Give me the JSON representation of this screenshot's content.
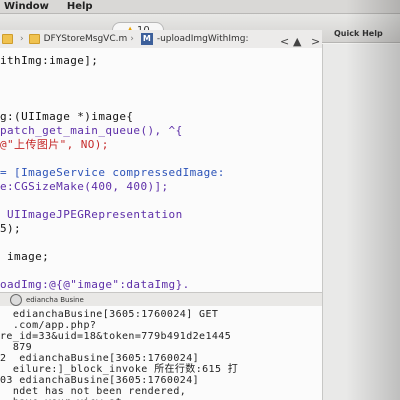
{
  "menu": [
    "Window",
    "Help"
  ],
  "toolbar": {
    "warning_count": "10"
  },
  "jumpbar": {
    "file_name": "DFYStoreMsgVC.m",
    "method_name": "-uploadImgWithImg:",
    "nav_prev": "<",
    "nav_next": ">"
  },
  "quick_help": {
    "title": "Quick Help"
  },
  "code_lines": [
    [
      {
        "text": "ithImg:image];",
        "class": "black"
      }
    ],
    [
      {
        "text": "",
        "class": "black"
      }
    ],
    [
      {
        "text": "",
        "class": "black"
      }
    ],
    [
      {
        "text": "",
        "class": "black"
      }
    ],
    [
      {
        "text": "g:(UIImage *)image{",
        "class": "black"
      }
    ],
    [
      {
        "text": "patch_get_main_queue(), ^{",
        "class": "purple"
      }
    ],
    [
      {
        "text": "@\"上传图片\", NO);",
        "class": "red"
      }
    ],
    [
      {
        "text": "",
        "class": "black"
      }
    ],
    [
      {
        "text": "= [ImageService compressedImage:",
        "class": "blue"
      }
    ],
    [
      {
        "text": "e:CGSizeMake(400, 400)];",
        "class": "purple"
      }
    ],
    [
      {
        "text": "",
        "class": "black"
      }
    ],
    [
      {
        "text": " UIImageJPEGRepresentation",
        "class": "purple"
      }
    ],
    [
      {
        "text": "5);",
        "class": "black"
      }
    ],
    [
      {
        "text": "",
        "class": "black"
      }
    ],
    [
      {
        "text": " image;",
        "class": "black"
      }
    ],
    [
      {
        "text": "",
        "class": "black"
      }
    ],
    [
      {
        "text": "oadImg:@{@\"image\":dataImg}.",
        "class": "purple"
      }
    ],
    [
      {
        "text": "success:^(id result) {",
        "class": "pink"
      }
    ],
    [
      {
        "text": "@\"result\"] isEqualToString:@\"0\"])",
        "class": "purple"
      }
    ],
    [
      {
        "text": "",
        "class": "black"
      }
    ],
    [
      {
        "text": "onary *arr = result[@\"data\"];",
        "class": "pink"
      }
    ],
    [
      {
        "text": ".count) {",
        "class": "black"
      }
    ]
  ],
  "debug": {
    "target": "ediancha Busine"
  },
  "console_lines": [
    "  edianchaBusine[3605:1760024] GET",
    "  .com/app.php?",
    "re_id=33&uid=18&token=779b491d2e1445",
    "  879",
    "2  edianchaBusine[3605:1760024]",
    "  eilure:]_block_invoke 所在行数:615 打",
    "03 edianchaBusine[3605:1760024]",
    "  ndet has not been rendered,",
    "  have your view at"
  ],
  "colors": {
    "editor_bg": "#fbfbfb",
    "keyword": "#c01f8f",
    "string": "#c52828",
    "method": "#5d2ea8",
    "type": "#2c53b8",
    "warning": "#e6a000"
  }
}
